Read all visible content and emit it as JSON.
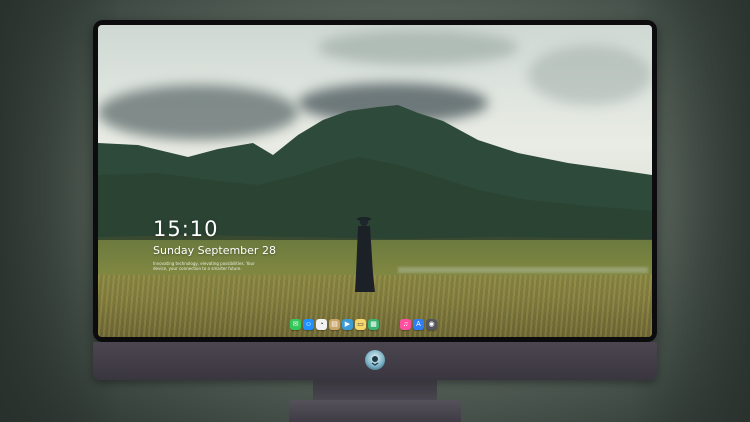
{
  "lockscreen": {
    "time": "15:10",
    "date": "Sunday September 28",
    "tagline": "Innovating technology, elevating possibilities. Your device, your connection to a smarter future."
  },
  "dock": {
    "apps_left": [
      {
        "name": "messages",
        "icon": "message-icon",
        "color": "#34c759",
        "glyph": "✉"
      },
      {
        "name": "finder",
        "icon": "finder-icon",
        "color": "#1e90ff",
        "glyph": "☺"
      },
      {
        "name": "clock",
        "icon": "clock-icon",
        "color": "#f2f2f2",
        "glyph": "◔"
      },
      {
        "name": "files",
        "icon": "files-icon",
        "color": "#c9a56a",
        "glyph": "▤"
      },
      {
        "name": "claquette",
        "icon": "clapper-icon",
        "color": "#3a9bd5",
        "glyph": "▶"
      },
      {
        "name": "notes",
        "icon": "notes-icon",
        "color": "#f5d76e",
        "glyph": "▭"
      },
      {
        "name": "photos",
        "icon": "photos-icon",
        "color": "#3cb371",
        "glyph": "▦"
      }
    ],
    "apps_right": [
      {
        "name": "music",
        "icon": "music-icon",
        "color": "#ff4fa0",
        "glyph": "♫"
      },
      {
        "name": "app-store",
        "icon": "app-store-icon",
        "color": "#2f7ef5",
        "glyph": "A"
      },
      {
        "name": "camera",
        "icon": "camera-icon",
        "color": "#55565c",
        "glyph": "◉"
      }
    ]
  },
  "colors": {
    "bezel": "#0c0c0e",
    "chin": "#4b4650",
    "stand": "#4c4851"
  }
}
